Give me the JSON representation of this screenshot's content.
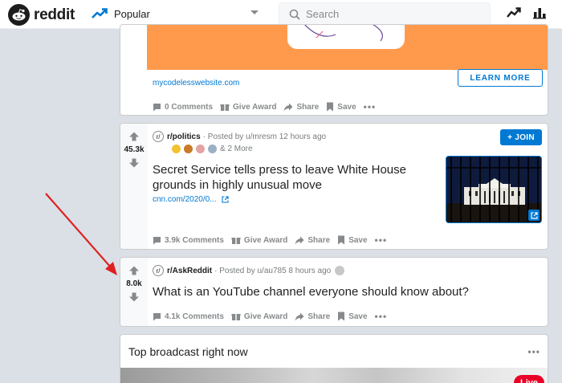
{
  "header": {
    "brand": "reddit",
    "feed": "Popular",
    "search_placeholder": "Search"
  },
  "ad_card": {
    "domain": "mycodelesswebsite.com",
    "cta": "LEARN MORE",
    "actions": {
      "comments": "0 Comments",
      "award": "Give Award",
      "share": "Share",
      "save": "Save"
    }
  },
  "post1": {
    "votes": "45.3k",
    "subreddit": "r/politics",
    "posted_by": "· Posted by u/mresm 12 hours ago",
    "more_awards": "& 2 More",
    "join": "+ JOIN",
    "title": "Secret Service tells press to leave White House grounds in highly unusual move",
    "link": "cnn.com/2020/0...",
    "actions": {
      "comments": "3.9k Comments",
      "award": "Give Award",
      "share": "Share",
      "save": "Save"
    }
  },
  "post2": {
    "votes": "8.0k",
    "subreddit": "r/AskReddit",
    "posted_by": "· Posted by u/au785 8 hours ago",
    "title": "What is an YouTube channel everyone should know about?",
    "actions": {
      "comments": "4.1k Comments",
      "award": "Give Award",
      "share": "Share",
      "save": "Save"
    }
  },
  "broadcast": {
    "title": "Top broadcast right now",
    "live": "Live"
  },
  "colors": {
    "accent": "#0079d3",
    "ad_banner": "#ff9a4d",
    "annotation_arrow": "#e02020",
    "live": "#ea0027"
  }
}
